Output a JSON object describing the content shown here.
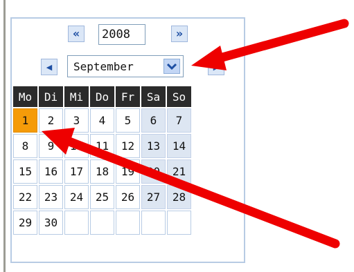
{
  "calendar": {
    "prev_year_label": "«",
    "next_year_label": "»",
    "year": "2008",
    "prev_month_label": "◀",
    "next_month_label": "▶",
    "month": "September",
    "weekdays": [
      "Mo",
      "Di",
      "Mi",
      "Do",
      "Fr",
      "Sa",
      "So"
    ],
    "weeks": [
      [
        "1",
        "2",
        "3",
        "4",
        "5",
        "6",
        "7"
      ],
      [
        "8",
        "9",
        "10",
        "11",
        "12",
        "13",
        "14"
      ],
      [
        "15",
        "16",
        "17",
        "18",
        "19",
        "20",
        "21"
      ],
      [
        "22",
        "23",
        "24",
        "25",
        "26",
        "27",
        "28"
      ],
      [
        "29",
        "30",
        "",
        "",
        "",
        "",
        ""
      ]
    ],
    "selected_day": "1"
  },
  "colors": {
    "header_bg": "#2b2b2b",
    "weekend_bg": "#dde6f2",
    "today_bg": "#f59b09",
    "arrow": "#ee0000"
  }
}
